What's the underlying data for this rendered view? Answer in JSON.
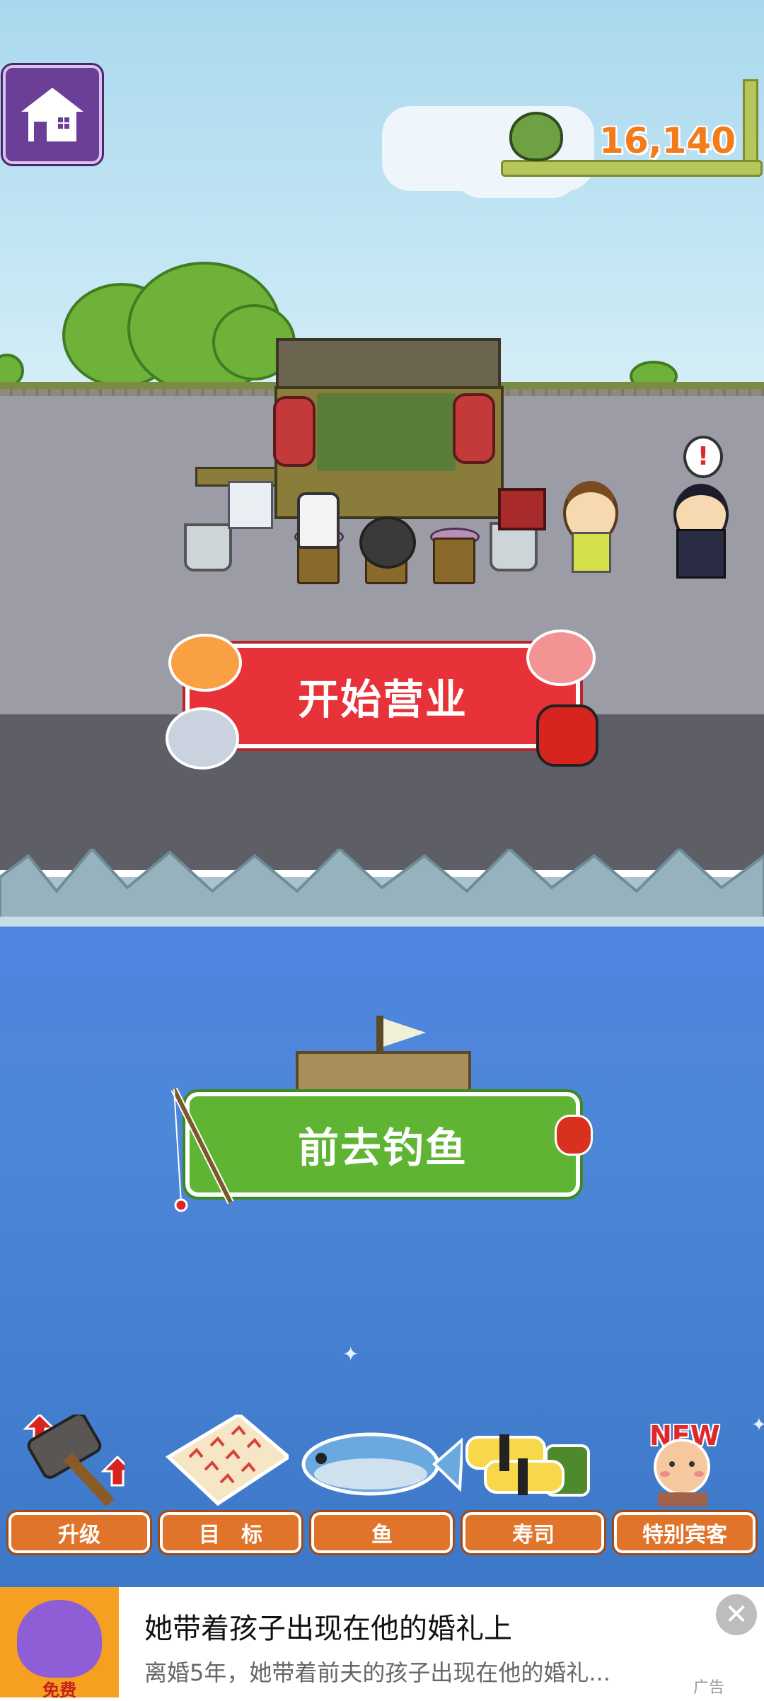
{
  "header": {
    "money": "16,140",
    "home_icon": "house-icon",
    "pouch_icon": "money-pouch-icon"
  },
  "main": {
    "open_shop_label": "开始营业",
    "go_fishing_label": "前去钓鱼"
  },
  "menu": {
    "items": [
      {
        "label": "升级",
        "icon": "hammer-icon"
      },
      {
        "label": "目　标",
        "icon": "goals-sheet-icon"
      },
      {
        "label": "鱼",
        "icon": "fish-icon"
      },
      {
        "label": "寿司",
        "icon": "sushi-icon"
      },
      {
        "label": "特别宾客",
        "icon": "special-guest-icon"
      }
    ],
    "new_badge": "NEW"
  },
  "ad": {
    "title": "她带着孩子出现在他的婚礼上",
    "subtitle": "离婚5年，她带着前夫的孩子出现在他的婚礼...",
    "image_caption": "免费",
    "tag": "广告",
    "close_icon": "close-icon"
  },
  "colors": {
    "open_button": "#e8323a",
    "fish_button": "#5fb533",
    "menu_button": "#e0742a",
    "money": "#f47b1a"
  }
}
